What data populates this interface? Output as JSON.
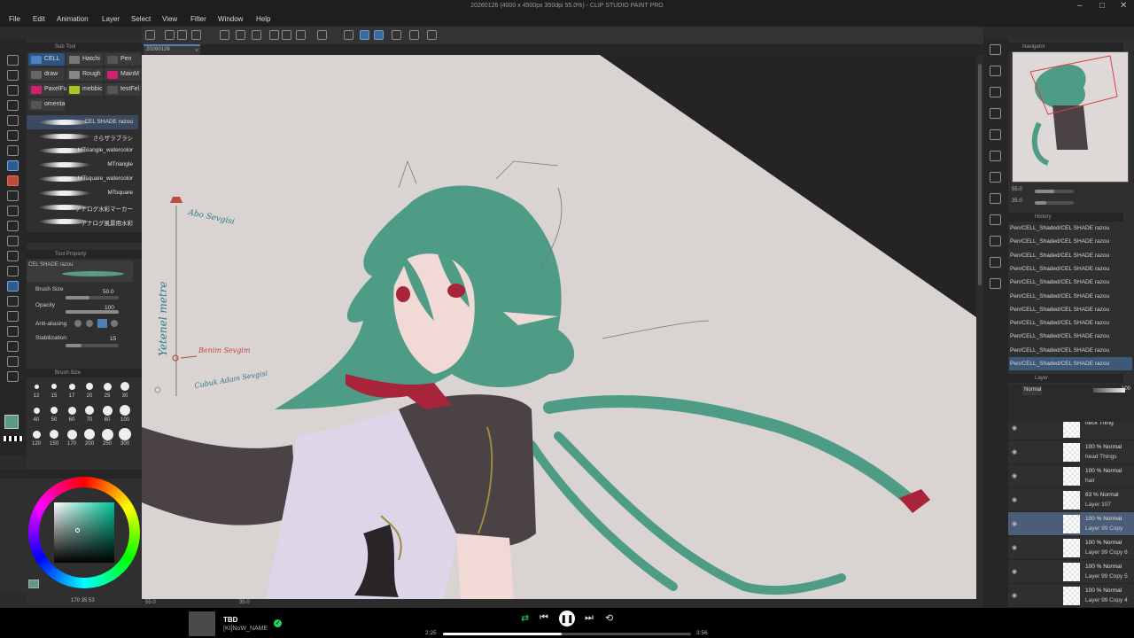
{
  "window": {
    "title": "20260126 (4000 x 4500px 350dpi 55.0%) - CLIP STUDIO PAINT PRO"
  },
  "menu": [
    "File",
    "Edit",
    "Animation",
    "Layer",
    "Select",
    "View",
    "Filter",
    "Window",
    "Help"
  ],
  "doc_tab": "20260126",
  "subtool": {
    "header": "Sub Tool",
    "groups": [
      {
        "label": "CELL",
        "color": "#2e5480",
        "swatch": "#4c82c2",
        "active": true
      },
      {
        "label": "Hatchi",
        "color": "#3a3a3a",
        "swatch": "#777"
      },
      {
        "label": "Pen",
        "color": "#3a3a3a",
        "swatch": "#555"
      },
      {
        "label": "draw",
        "color": "#3a3a3a",
        "swatch": "#666"
      },
      {
        "label": "Rough",
        "color": "#3a3a3a",
        "swatch": "#888"
      },
      {
        "label": "MainM",
        "color": "#3a3a3a",
        "swatch": "#d0216e"
      },
      {
        "label": "PaxelFu",
        "color": "#3a3a3a",
        "swatch": "#d0216e"
      },
      {
        "label": "mebbic",
        "color": "#3a3a3a",
        "swatch": "#a6c91f"
      },
      {
        "label": "testFel",
        "color": "#3a3a3a",
        "swatch": "#555"
      },
      {
        "label": "omenta",
        "color": "#3a3a3a",
        "swatch": "#555"
      }
    ],
    "brushes": [
      "CEL SHADE razou",
      "さらザラブラシ",
      "MTriangle_watercolor",
      "MTriangle",
      "MTsquare_watercolor",
      "MTsquare",
      "アナログ水彩マーカー",
      "アナログ風景用水彩"
    ]
  },
  "tool_property": {
    "header": "Tool Property",
    "brush_name": "CEL SHADE razou",
    "brush_size_label": "Brush Size",
    "brush_size": "50.0",
    "brush_size_frac": 0.45,
    "opacity_label": "Opacity",
    "opacity": "100",
    "opacity_frac": 1.0,
    "antialias_label": "Anti-aliasing",
    "stabilization_label": "Stabilization",
    "stabilization": "15",
    "stabilization_frac": 0.3
  },
  "brush_size_palette": {
    "header": "Brush Size",
    "sizes": [
      "12",
      "15",
      "17",
      "20",
      "25",
      "30",
      "40",
      "50",
      "60",
      "70",
      "80",
      "100",
      "120",
      "150",
      "170",
      "200",
      "250",
      "300"
    ]
  },
  "color": {
    "main": "#5a9a88",
    "readout": "170  35  53"
  },
  "canvas": {
    "annotations": {
      "top": "Abo Sevgisi",
      "vertical": "Yetenel metre",
      "middle": "Benim Sevgim",
      "bottom": "Cubuk Adam Sevgisi"
    },
    "zoom": "55.0",
    "angle": "35.0"
  },
  "navigator": {
    "header": "Navigator",
    "zoom": "55.0",
    "angle": "35.0"
  },
  "history": {
    "header": "History",
    "items": [
      "Pen/CELL_Shaded/CEL SHADE razou",
      "Pen/CELL_Shaded/CEL SHADE razou",
      "Pen/CELL_Shaded/CEL SHADE razou",
      "Pen/CELL_Shaded/CEL SHADE razou",
      "Pen/CELL_Shaded/CEL SHADE razou",
      "Pen/CELL_Shaded/CEL SHADE razou",
      "Pen/CELL_Shaded/CEL SHADE razou",
      "Pen/CELL_Shaded/CEL SHADE razou",
      "Pen/CELL_Shaded/CEL SHADE razou",
      "Pen/CELL_Shaded/CEL SHADE razou",
      "Pen/CELL_Shaded/CEL SHADE razou"
    ]
  },
  "layers": {
    "header": "Layer",
    "blend": "Normal",
    "opacity": "100",
    "items": [
      {
        "l1": "neck Thing",
        "l2": "",
        "active": false
      },
      {
        "l1": "100 % Normal",
        "l2": "head Things",
        "active": false
      },
      {
        "l1": "100 % Normal",
        "l2": "hair",
        "active": false
      },
      {
        "l1": "63 % Normal",
        "l2": "Layer 107",
        "active": false
      },
      {
        "l1": "100 % Normal",
        "l2": "Layer 99 Copy",
        "active": true
      },
      {
        "l1": "100 % Normal",
        "l2": "Layer 99 Copy 6",
        "active": false
      },
      {
        "l1": "100 % Normal",
        "l2": "Layer 99 Copy 5",
        "active": false
      },
      {
        "l1": "100 % Normal",
        "l2": "Layer 99 Copy 4",
        "active": false
      },
      {
        "l1": "100 % Normal",
        "l2": "",
        "active": false
      }
    ]
  },
  "player": {
    "title": "TBD",
    "artist": "[KI]NoW_NAME",
    "elapsed": "2:25",
    "total": "3:56",
    "progress": 0.48
  }
}
